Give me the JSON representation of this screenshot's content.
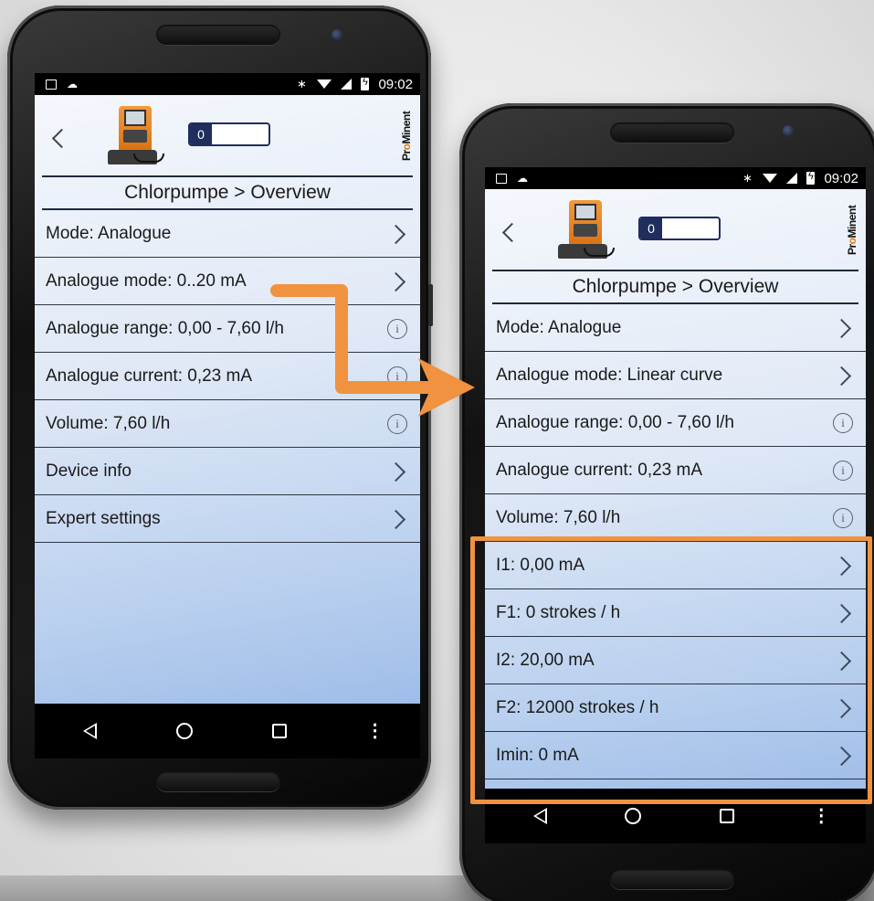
{
  "time": "09:02",
  "left_phone": {
    "counter": "0",
    "breadcrumb": "Chlorpumpe > Overview",
    "items": [
      {
        "label": "Mode: Analogue",
        "icon": "chevron"
      },
      {
        "label": "Analogue mode: 0..20 mA",
        "icon": "chevron"
      },
      {
        "label": "Analogue range: 0,00 - 7,60 l/h",
        "icon": "info"
      },
      {
        "label": "Analogue current: 0,23 mA",
        "icon": "info"
      },
      {
        "label": "Volume: 7,60 l/h",
        "icon": "info"
      },
      {
        "label": "Device info",
        "icon": "chevron"
      },
      {
        "label": "Expert settings",
        "icon": "chevron"
      }
    ]
  },
  "right_phone": {
    "counter": "0",
    "breadcrumb": "Chlorpumpe > Overview",
    "items": [
      {
        "label": "Mode: Analogue",
        "icon": "chevron"
      },
      {
        "label": "Analogue mode: Linear curve",
        "icon": "chevron"
      },
      {
        "label": "Analogue range: 0,00 - 7,60 l/h",
        "icon": "info"
      },
      {
        "label": "Analogue current: 0,23 mA",
        "icon": "info"
      },
      {
        "label": "Volume: 7,60 l/h",
        "icon": "info"
      },
      {
        "label": "I1: 0,00 mA",
        "icon": "chevron"
      },
      {
        "label": "F1: 0 strokes / h",
        "icon": "chevron"
      },
      {
        "label": "I2: 20,00 mA",
        "icon": "chevron"
      },
      {
        "label": "F2: 12000 strokes / h",
        "icon": "chevron"
      },
      {
        "label": "Imin: 0 mA",
        "icon": "chevron"
      }
    ]
  },
  "brand": {
    "pre": "Pr",
    "mid": "o",
    "post": "Minent"
  },
  "colors": {
    "accent_orange": "#f0923f",
    "counter_navy": "#1f2e5c"
  },
  "info_glyph": "i",
  "more_glyph": "⋮",
  "bluetooth_glyph": "∗"
}
